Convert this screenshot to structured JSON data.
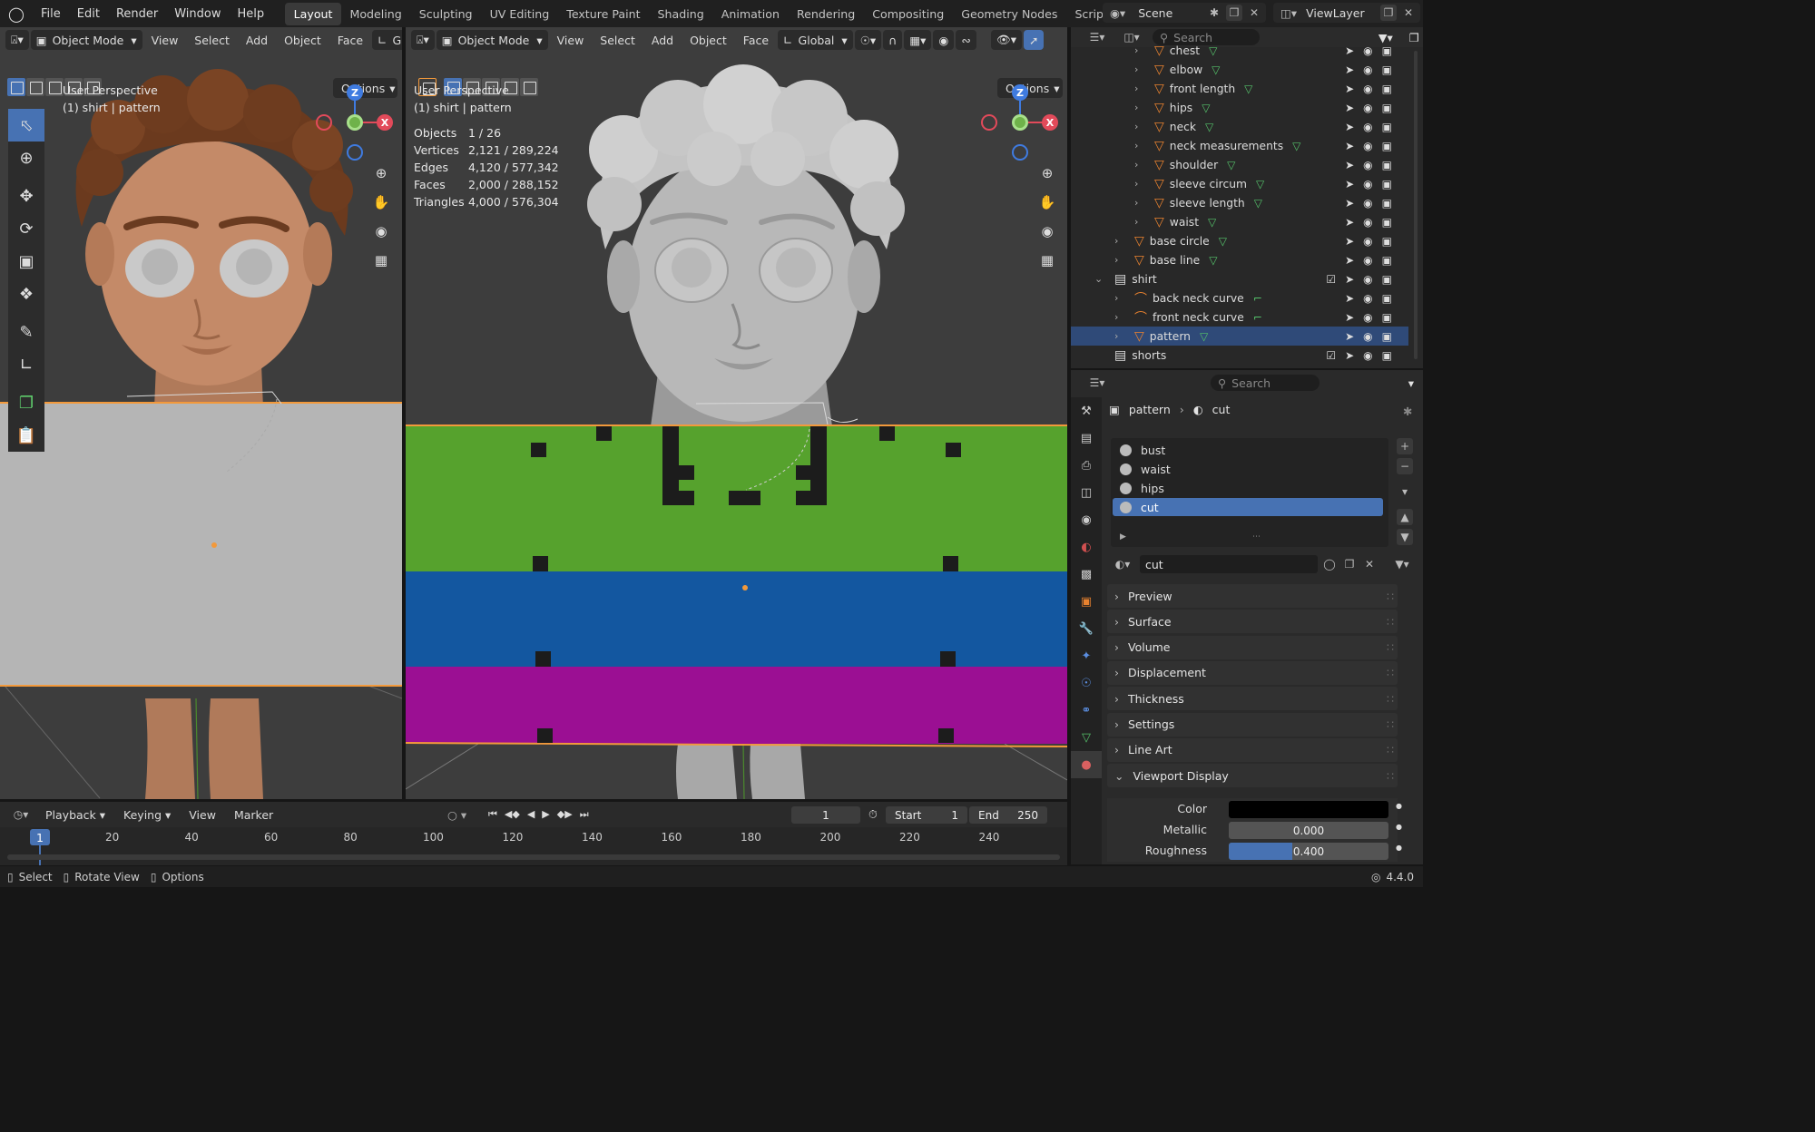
{
  "app": {
    "menu": [
      "File",
      "Edit",
      "Render",
      "Window",
      "Help"
    ],
    "workspaces": [
      "Layout",
      "Modeling",
      "Sculpting",
      "UV Editing",
      "Texture Paint",
      "Shading",
      "Animation",
      "Rendering",
      "Compositing",
      "Geometry Nodes",
      "Scripting"
    ],
    "active_workspace": "Layout",
    "scene": "Scene",
    "view_layer": "ViewLayer"
  },
  "viewport_left": {
    "mode": "Object Mode",
    "menus": [
      "View",
      "Select",
      "Add",
      "Object",
      "Face"
    ],
    "transform_partial": "Gl",
    "options": "Options",
    "perspective": "User Perspective",
    "active": "(1) shirt | pattern"
  },
  "viewport_right": {
    "mode": "Object Mode",
    "menus": [
      "View",
      "Select",
      "Add",
      "Object",
      "Face"
    ],
    "orientation": "Global",
    "options": "Options",
    "perspective": "User Perspective",
    "active": "(1) shirt | pattern",
    "stats": [
      {
        "label": "Objects",
        "value": "1 / 26"
      },
      {
        "label": "Vertices",
        "value": "2,121 / 289,224"
      },
      {
        "label": "Edges",
        "value": "4,120 / 577,342"
      },
      {
        "label": "Faces",
        "value": "2,000 / 288,152"
      },
      {
        "label": "Triangles",
        "value": "4,000 / 576,304"
      }
    ],
    "colors": {
      "green": "#56a22d",
      "blue": "#1357a0",
      "magenta": "#9b0f93"
    }
  },
  "gizmo": {
    "z": "Z",
    "x": "X"
  },
  "outliner": {
    "search_placeholder": "Search",
    "rows": [
      {
        "label": "chest",
        "indent": 3
      },
      {
        "label": "elbow",
        "indent": 3
      },
      {
        "label": "front length",
        "indent": 3
      },
      {
        "label": "hips",
        "indent": 3
      },
      {
        "label": "neck",
        "indent": 3
      },
      {
        "label": "neck measurements",
        "indent": 3
      },
      {
        "label": "shoulder",
        "indent": 3
      },
      {
        "label": "sleeve circum",
        "indent": 3
      },
      {
        "label": "sleeve length",
        "indent": 3
      },
      {
        "label": "waist",
        "indent": 3
      },
      {
        "label": "base circle",
        "indent": 2
      },
      {
        "label": "base line",
        "indent": 2
      },
      {
        "label": "shirt",
        "indent": 1
      },
      {
        "label": "back neck curve",
        "indent": 2
      },
      {
        "label": "front neck curve",
        "indent": 2
      },
      {
        "label": "pattern",
        "indent": 2
      },
      {
        "label": "shorts",
        "indent": 1
      }
    ]
  },
  "properties": {
    "search_placeholder": "Search",
    "breadcrumb_object": "pattern",
    "breadcrumb_material": "cut",
    "slots": [
      "bust",
      "waist",
      "hips",
      "cut"
    ],
    "selected_slot": "cut",
    "material_name": "cut",
    "panels": [
      "Preview",
      "Surface",
      "Volume",
      "Displacement",
      "Thickness",
      "Settings",
      "Line Art",
      "Viewport Display"
    ],
    "color_label": "Color",
    "color_value": "#000000",
    "metallic_label": "Metallic",
    "metallic": "0.000",
    "roughness_label": "Roughness",
    "roughness": "0.400",
    "roughness_fraction": 0.4
  },
  "timeline": {
    "menus": [
      "Playback",
      "Keying",
      "View",
      "Marker"
    ],
    "current_frame": "1",
    "start_label": "Start",
    "start": "1",
    "end_label": "End",
    "end": "250",
    "ruler": [
      "20",
      "40",
      "60",
      "80",
      "100",
      "120",
      "140",
      "160",
      "180",
      "200",
      "220",
      "240"
    ],
    "ruler_current": "1"
  },
  "status": {
    "select": "Select",
    "rotate": "Rotate View",
    "options": "Options",
    "version": "4.4.0"
  }
}
